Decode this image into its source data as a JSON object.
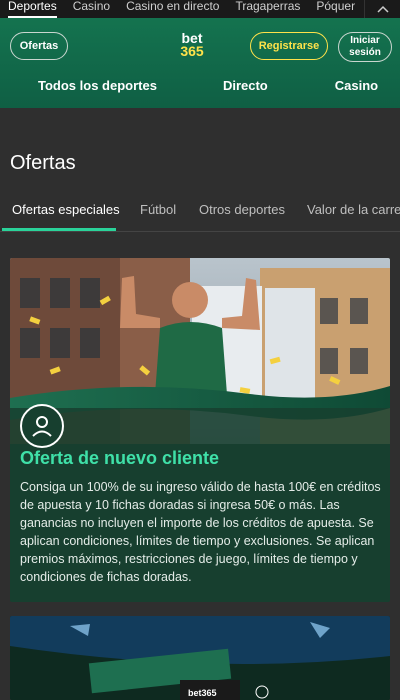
{
  "topnav": {
    "items": [
      "Deportes",
      "Casino",
      "Casino en directo",
      "Tragaperras",
      "Póquer"
    ],
    "chevron_icon": "chevron-up-icon"
  },
  "header": {
    "ofertas_label": "Ofertas",
    "logo_top": "bet",
    "logo_bottom": "365",
    "register_label": "Registrarse",
    "login_label_1": "Iniciar",
    "login_label_2": "sesión"
  },
  "mainnav": {
    "items": [
      "Todos los deportes",
      "Directo",
      "Casino"
    ]
  },
  "page": {
    "title": "Ofertas"
  },
  "tabs": {
    "items": [
      "Ofertas especiales",
      "Fútbol",
      "Otros deportes",
      "Valor de la carrera"
    ],
    "active_index": 0
  },
  "offer": {
    "title": "Oferta de nuevo cliente",
    "description": "Consiga un 100% de su ingreso válido de hasta 100€ en créditos de apuesta y 10 fichas doradas si ingresa 50€ o más. Las ganancias no incluyen el importe de los créditos de apuesta. Se aplican condiciones, límites de tiempo y exclusiones. Se aplican premios máximos, restricciones de juego, límites de tiempo y condiciones de fichas doradas.",
    "icon": "user-icon"
  },
  "card2": {
    "banner_text": "bet365"
  },
  "colors": {
    "header_green": "#14734f",
    "accent_yellow": "#ffe24a",
    "accent_mint": "#3fe0a8",
    "background": "#2f2f2f"
  }
}
